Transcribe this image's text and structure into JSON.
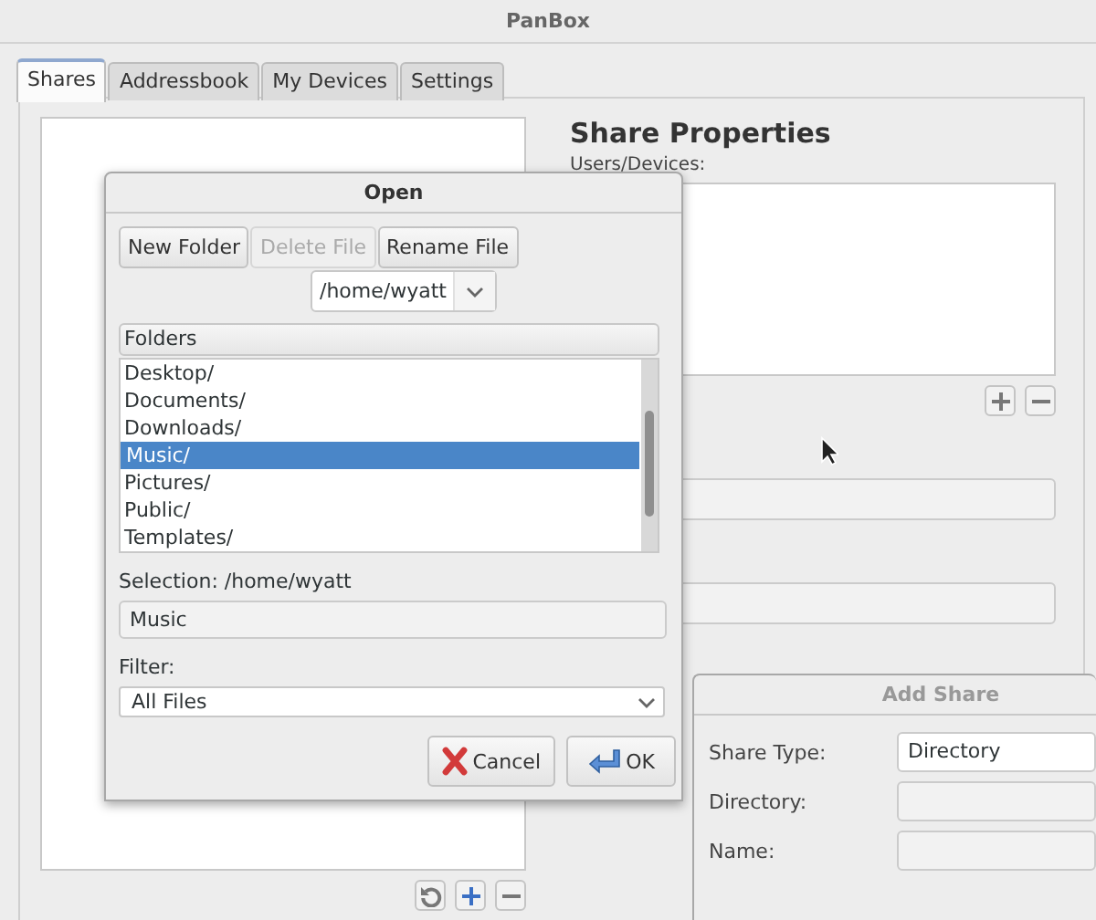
{
  "window": {
    "title": "PanBox"
  },
  "tabs": [
    {
      "label": "Shares",
      "selected": true
    },
    {
      "label": "Addressbook",
      "selected": false
    },
    {
      "label": "My Devices",
      "selected": false
    },
    {
      "label": "Settings",
      "selected": false
    }
  ],
  "share_properties": {
    "heading": "Share Properties",
    "users_label": "Users/Devices:"
  },
  "open_dialog": {
    "title": "Open",
    "active": true,
    "buttons": [
      {
        "label": "New Folder",
        "disabled": false
      },
      {
        "label": "Delete File",
        "disabled": true
      },
      {
        "label": "Rename File",
        "disabled": false
      }
    ],
    "path": "/home/wyatt",
    "list_header": "Folders",
    "folders": [
      {
        "name": "Desktop/",
        "selected": false
      },
      {
        "name": "Documents/",
        "selected": false
      },
      {
        "name": "Downloads/",
        "selected": false
      },
      {
        "name": "Music/",
        "selected": true
      },
      {
        "name": "Pictures/",
        "selected": false
      },
      {
        "name": "Public/",
        "selected": false
      },
      {
        "name": "Templates/",
        "selected": false
      }
    ],
    "selection_label": "Selection: /home/wyatt",
    "selection_value": "Music",
    "filter_label": "Filter:",
    "filter_value": "All Files",
    "cancel": "Cancel",
    "ok": "OK"
  },
  "add_share_dialog": {
    "title": "Add Share",
    "active": false,
    "fields": [
      {
        "label": "Share Type:",
        "value": "Directory",
        "disabled": false
      },
      {
        "label": "Directory:",
        "disabled": true
      },
      {
        "label": "Name:",
        "disabled": true
      }
    ]
  }
}
